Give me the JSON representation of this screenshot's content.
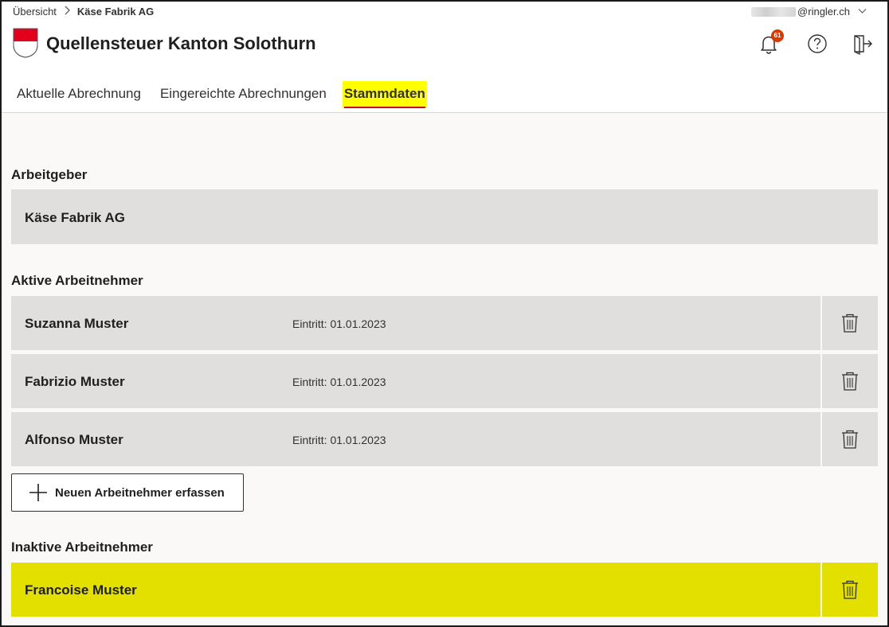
{
  "breadcrumb": {
    "home": "Übersicht",
    "current": "Käse Fabrik AG"
  },
  "user": {
    "email_suffix": "@ringler.ch"
  },
  "app": {
    "title": "Quellensteuer Kanton Solothurn"
  },
  "notifications": {
    "count": "61"
  },
  "tabs": [
    {
      "label": "Aktuelle Abrechnung"
    },
    {
      "label": "Eingereichte Abrechnungen"
    },
    {
      "label": "Stammdaten"
    }
  ],
  "employer": {
    "section_title": "Arbeitgeber",
    "name": "Käse Fabrik AG"
  },
  "active": {
    "section_title": "Aktive Arbeitnehmer",
    "employees": [
      {
        "name": "Suzanna Muster",
        "entry": "Eintritt: 01.01.2023"
      },
      {
        "name": "Fabrizio Muster",
        "entry": "Eintritt: 01.01.2023"
      },
      {
        "name": "Alfonso Muster",
        "entry": "Eintritt: 01.01.2023"
      }
    ],
    "add_label": "Neuen Arbeitnehmer erfassen"
  },
  "inactive": {
    "section_title": "Inaktive Arbeitnehmer",
    "employees": [
      {
        "name": "Francoise Muster"
      }
    ]
  },
  "colors": {
    "accent": "#c50f1f",
    "highlight_tab": "#ffff00",
    "highlight_row": "#e3e000",
    "badge": "#d83b01"
  },
  "icons": {
    "crest": "solothurn-crest-icon",
    "bell": "bell-icon",
    "help": "help-icon",
    "logout": "logout-icon",
    "delete": "trash-icon",
    "add": "plus-icon"
  }
}
